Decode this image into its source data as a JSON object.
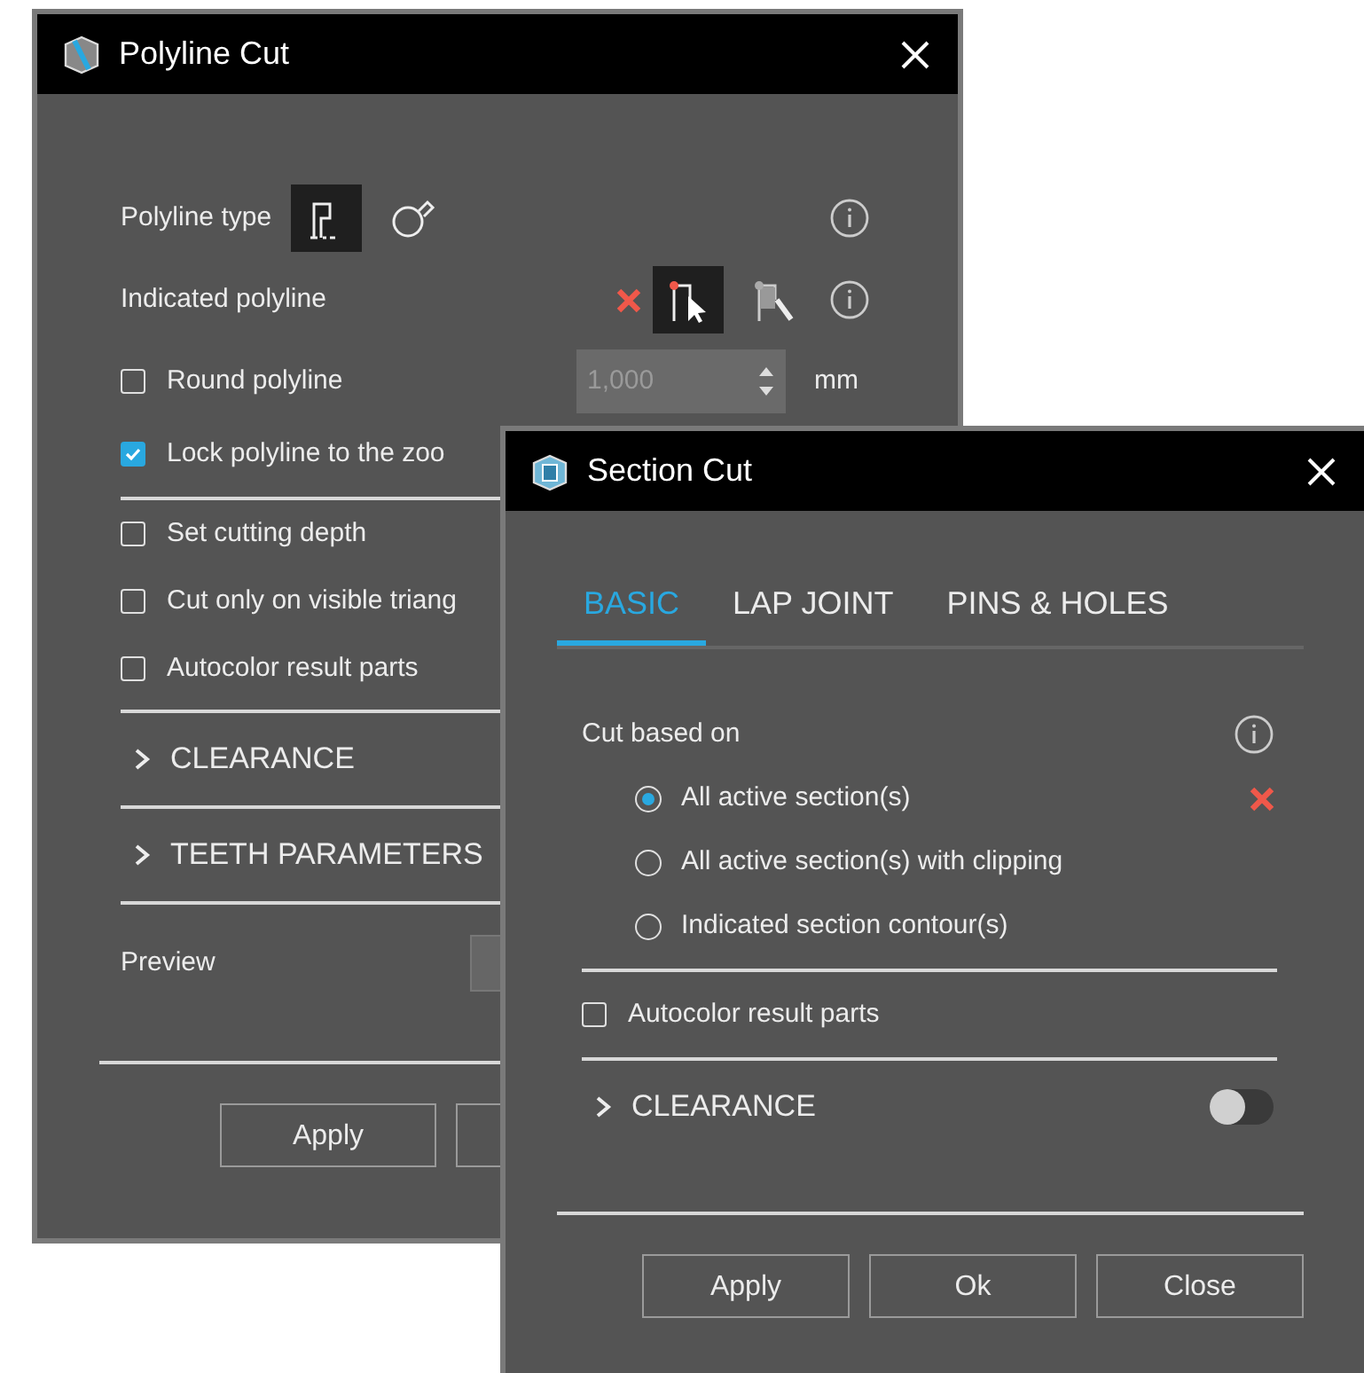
{
  "polyline_cut": {
    "title": "Polyline Cut",
    "polyline_type": {
      "label": "Polyline type",
      "options": [
        {
          "kind": "polyline",
          "selected": true
        },
        {
          "kind": "freeform",
          "selected": false
        }
      ]
    },
    "indicated_polyline": {
      "label": "Indicated polyline",
      "tools": [
        {
          "kind": "pick",
          "selected": true
        },
        {
          "kind": "draw",
          "selected": false
        }
      ]
    },
    "round_polyline": {
      "label": "Round polyline",
      "checked": false,
      "value": "1,000",
      "unit": "mm",
      "disabled": true
    },
    "lock": {
      "label": "Lock polyline to the zoo",
      "checked": true
    },
    "options": [
      {
        "label": "Set cutting depth",
        "checked": false
      },
      {
        "label": "Cut only on visible triang",
        "checked": false
      },
      {
        "label": "Autocolor result parts",
        "checked": false
      }
    ],
    "sections": [
      {
        "label": "CLEARANCE",
        "expanded": false
      },
      {
        "label": "TEETH PARAMETERS",
        "expanded": false
      }
    ],
    "preview": {
      "label": "Preview"
    },
    "buttons": [
      "Apply"
    ]
  },
  "section_cut": {
    "title": "Section Cut",
    "tabs": [
      {
        "label": "BASIC",
        "selected": true
      },
      {
        "label": "LAP JOINT",
        "selected": false
      },
      {
        "label": "PINS & HOLES",
        "selected": false
      }
    ],
    "cut_based_on": {
      "label": "Cut based on",
      "options": [
        {
          "label": "All active section(s)",
          "selected": true
        },
        {
          "label": "All active section(s) with clipping",
          "selected": false
        },
        {
          "label": "Indicated section contour(s)",
          "selected": false
        }
      ]
    },
    "autocolor": {
      "label": "Autocolor result parts",
      "checked": false
    },
    "clearance": {
      "label": "CLEARANCE",
      "expanded": false,
      "on": false
    },
    "buttons": [
      "Apply",
      "Ok",
      "Close"
    ]
  }
}
